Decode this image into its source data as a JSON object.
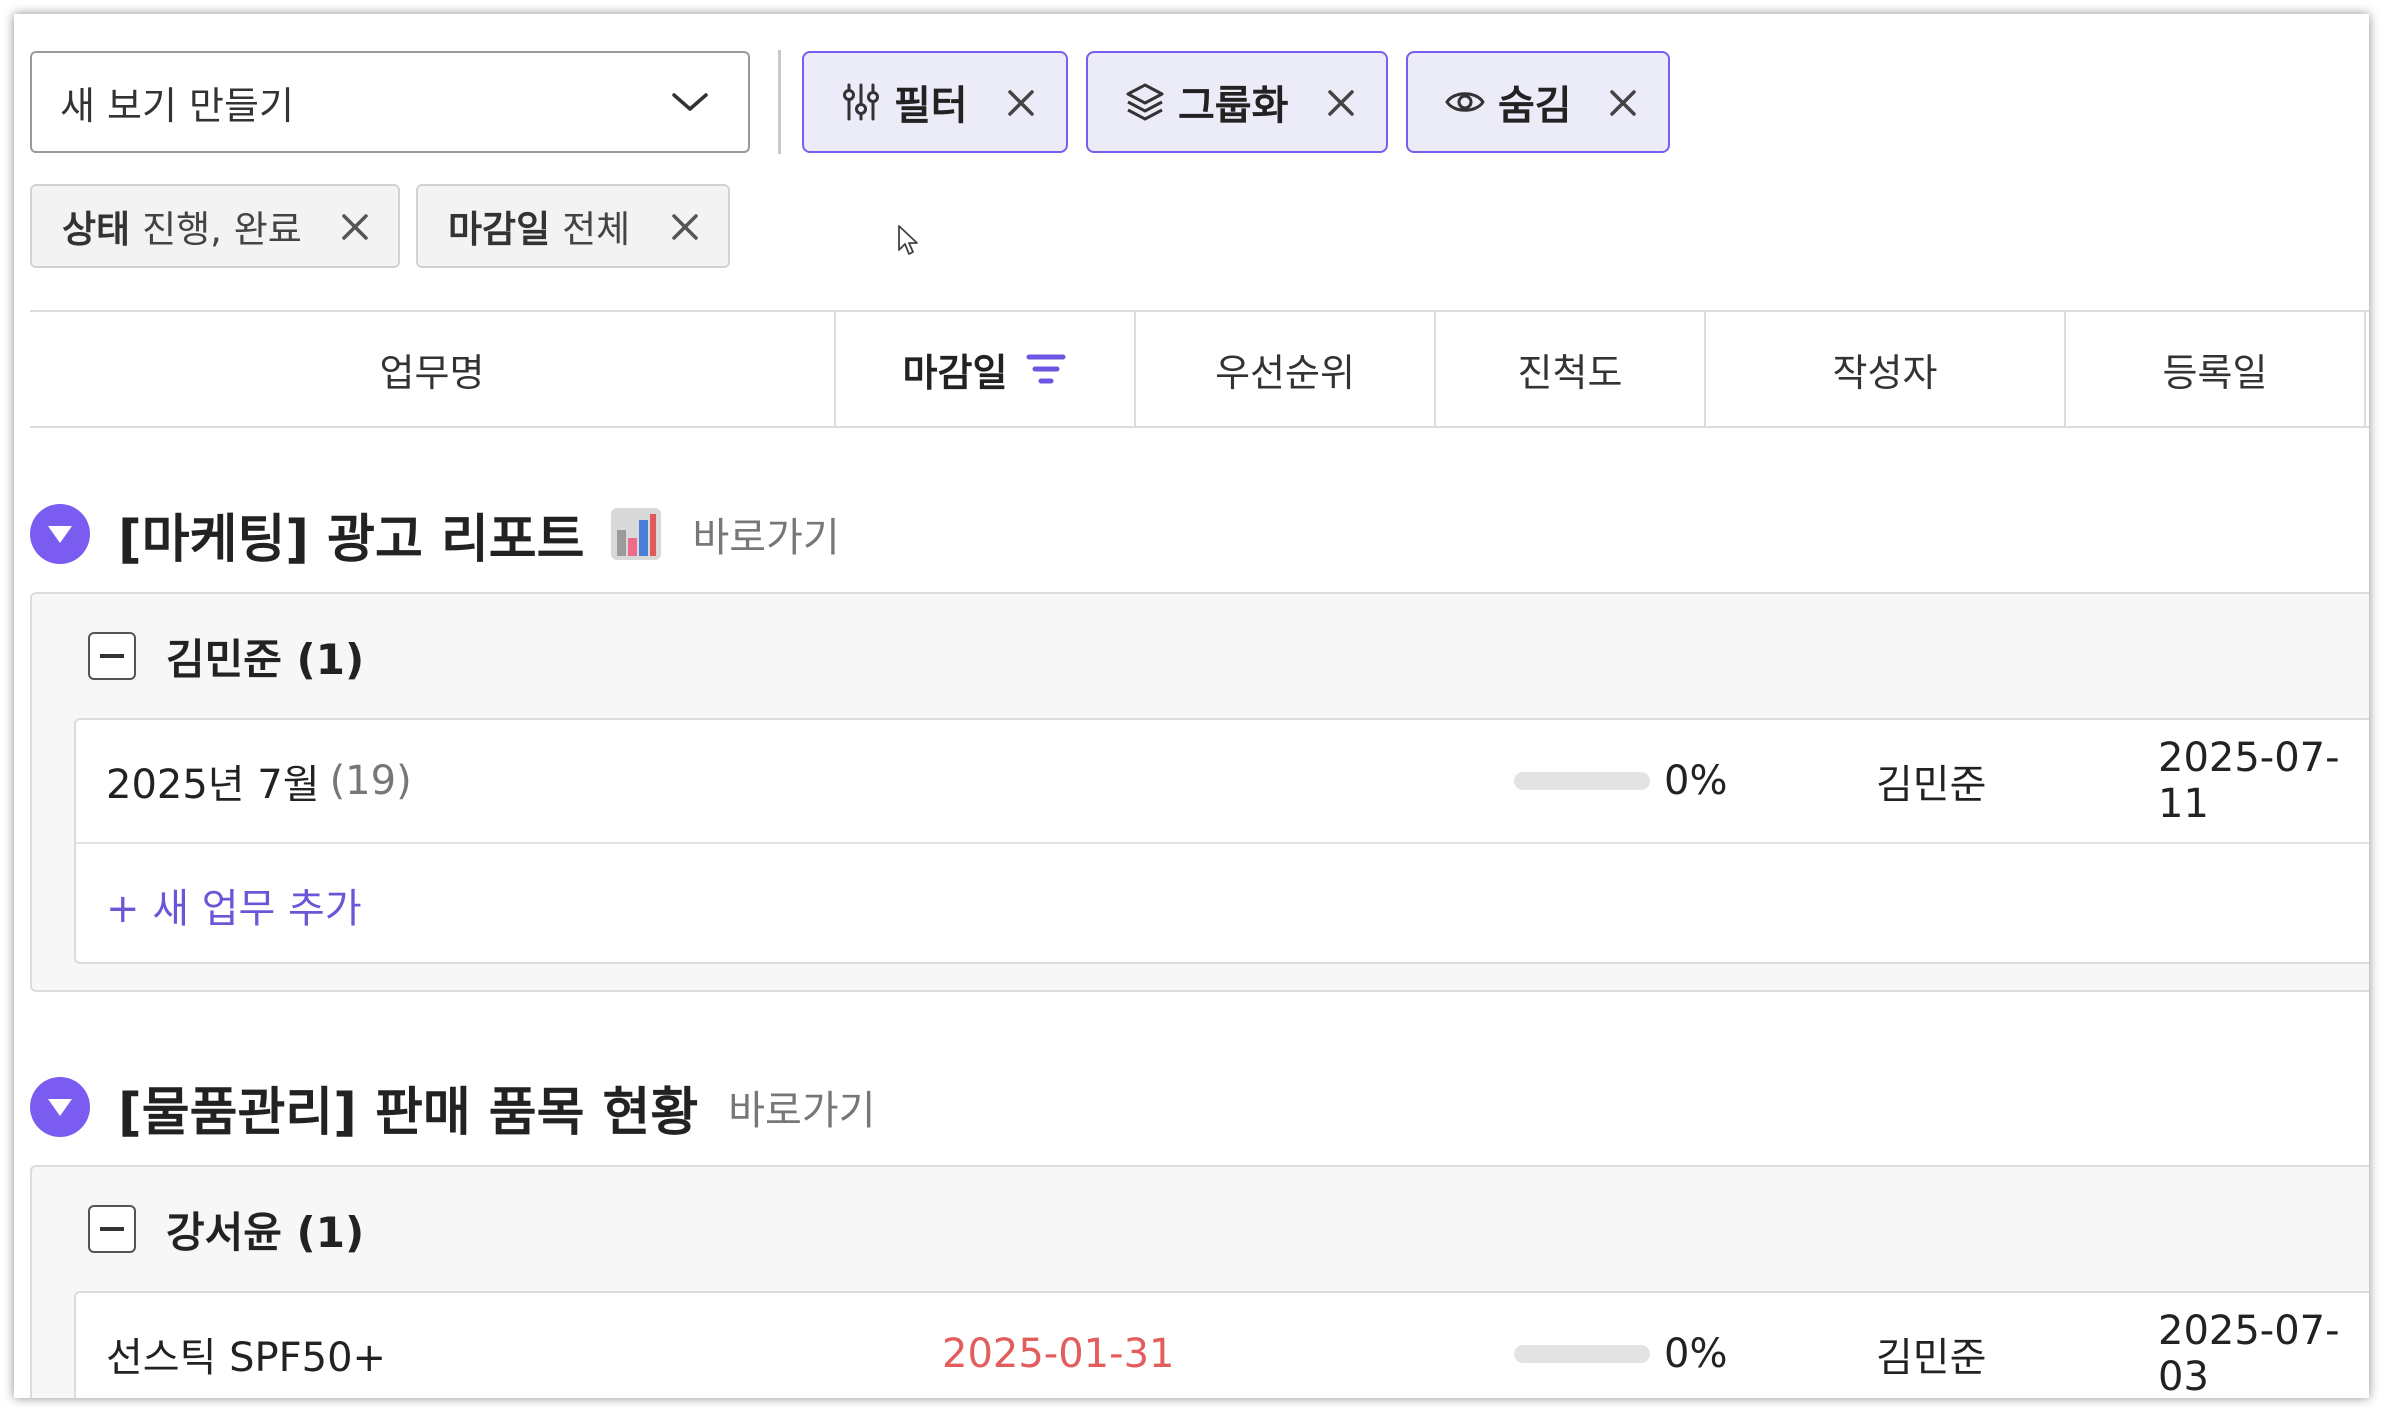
{
  "toolbar": {
    "view_select": {
      "value": "새 보기 만들기"
    },
    "filter_label": "필터",
    "group_label": "그룹화",
    "hide_label": "숨김"
  },
  "active_filters": [
    {
      "key": "상태",
      "value": "진행, 완료"
    },
    {
      "key": "마감일",
      "value": "전체"
    }
  ],
  "columns": {
    "task": "업무명",
    "due": "마감일",
    "priority": "우선순위",
    "progress": "진척도",
    "author": "작성자",
    "created": "등록일"
  },
  "groups": [
    {
      "title": "[마케팅] 광고 리포트",
      "icon": "bar-chart-icon",
      "link_label": "바로가기",
      "subgroups": [
        {
          "name": "김민준 (1)",
          "rows": [
            {
              "task": "2025년 7월",
              "count": "(19)",
              "due": "",
              "progress": 0,
              "progress_label": "0%",
              "author": "김민준",
              "created": "2025-07-11"
            }
          ],
          "add_label": "+ 새 업무 추가"
        }
      ]
    },
    {
      "title": "[물품관리] 판매 품목 현황",
      "link_label": "바로가기",
      "subgroups": [
        {
          "name": "강서윤 (1)",
          "rows": [
            {
              "task": "선스틱 SPF50+",
              "due": "2025-01-31",
              "due_color": "#e35d5d",
              "progress": 0,
              "progress_label": "0%",
              "author": "김민준",
              "created": "2025-07-03"
            }
          ]
        }
      ]
    }
  ],
  "colors": {
    "accent": "#7b5cf0",
    "overdue": "#e35d5d",
    "accent_bg": "#ecebf8"
  }
}
